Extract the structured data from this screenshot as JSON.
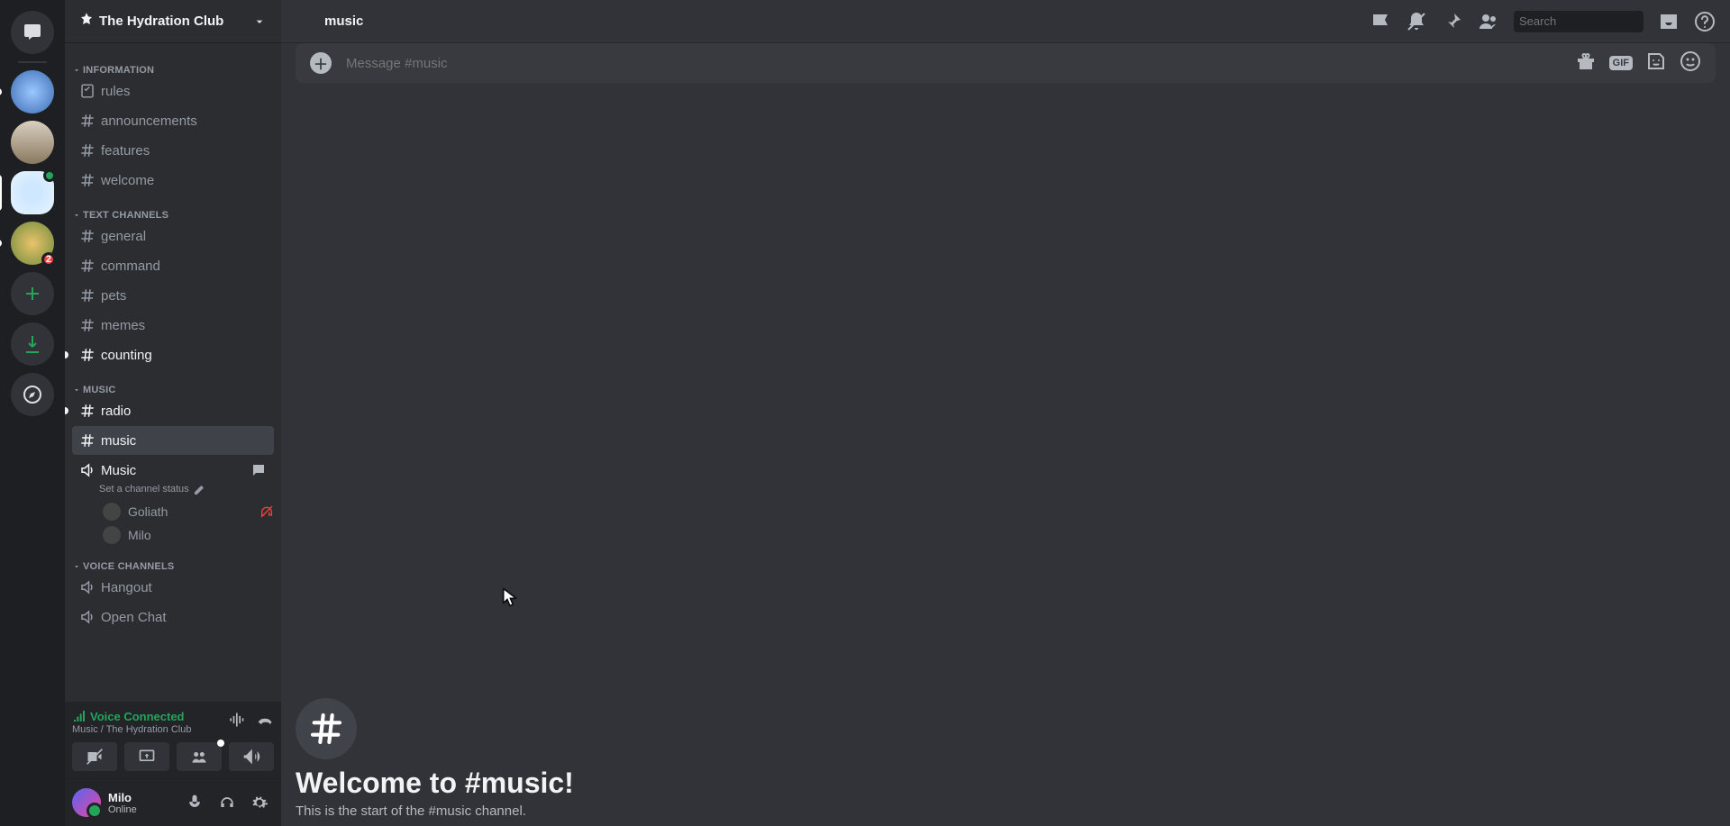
{
  "server_name": "The Hydration Club",
  "active_channel": "music",
  "topbar": {
    "search_placeholder": "Search"
  },
  "categories": [
    {
      "label": "INFORMATION",
      "channels": [
        {
          "name": "rules",
          "type": "rules"
        },
        {
          "name": "announcements",
          "type": "text"
        },
        {
          "name": "features",
          "type": "text"
        },
        {
          "name": "welcome",
          "type": "text"
        }
      ]
    },
    {
      "label": "TEXT CHANNELS",
      "channels": [
        {
          "name": "general",
          "type": "text"
        },
        {
          "name": "command",
          "type": "text"
        },
        {
          "name": "pets",
          "type": "text"
        },
        {
          "name": "memes",
          "type": "text"
        },
        {
          "name": "counting",
          "type": "text",
          "unread": true
        }
      ]
    },
    {
      "label": "MUSIC",
      "channels": [
        {
          "name": "radio",
          "type": "text",
          "unread": true
        },
        {
          "name": "music",
          "type": "text",
          "selected": true
        }
      ]
    }
  ],
  "voice_channel": {
    "name": "Music",
    "status_prompt": "Set a channel status",
    "members": [
      {
        "name": "Goliath",
        "deafened": true
      },
      {
        "name": "Milo"
      }
    ]
  },
  "voice_category": {
    "label": "VOICE CHANNELS",
    "channels": [
      "Hangout",
      "Open Chat"
    ]
  },
  "connection": {
    "title": "Voice Connected",
    "subtitle": "Music / The Hydration Club"
  },
  "user": {
    "name": "Milo",
    "status": "Online"
  },
  "welcome": {
    "title": "Welcome to #music!",
    "subtitle": "This is the start of the #music channel."
  },
  "composer": {
    "placeholder": "Message #music"
  },
  "server_rail": {
    "duck_badge": "2"
  }
}
